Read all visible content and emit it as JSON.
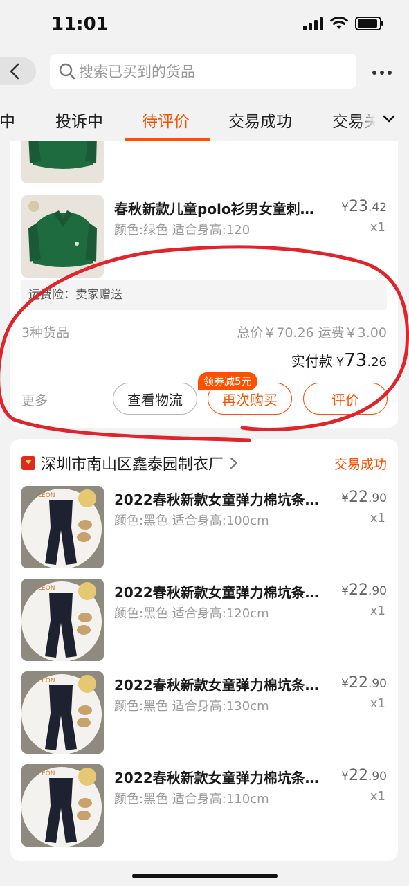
{
  "status_bar": {
    "time": "11:01"
  },
  "search": {
    "placeholder": "搜索已买到的货品"
  },
  "tabs": [
    {
      "label": "售中"
    },
    {
      "label": "投诉中"
    },
    {
      "label": "待评价",
      "active": true
    },
    {
      "label": "交易成功"
    },
    {
      "label": "交易关闭"
    }
  ],
  "order1": {
    "item": {
      "title": "春秋新款儿童polo衫男女童刺…",
      "sku": "颜色:绿色  适合身高:120",
      "price_currency": "¥",
      "price_int": "23",
      "price_dec": ".42",
      "qty": "x1"
    },
    "insurance": "运费险：卖家赠送",
    "goods_count": "3种货品",
    "total": "总价￥70.26   运费￥3.00",
    "paid_label": "实付款",
    "paid_currency": "¥",
    "paid_int": "73",
    "paid_dec": ".26",
    "more": "更多",
    "coupon_badge": "领券减5元",
    "btn_logistics": "查看物流",
    "btn_rebuy": "再次购买",
    "btn_review": "评价"
  },
  "order2": {
    "shop_name": "深圳市南山区鑫泰园制衣厂",
    "status": "交易成功",
    "items": [
      {
        "title": "2022春秋新款女童弹力棉坑条…",
        "sku": "颜色:黑色  适合身高:100cm",
        "price_currency": "¥",
        "price_int": "22",
        "price_dec": ".90",
        "qty": "x1"
      },
      {
        "title": "2022春秋新款女童弹力棉坑条…",
        "sku": "颜色:黑色  适合身高:120cm",
        "price_currency": "¥",
        "price_int": "22",
        "price_dec": ".90",
        "qty": "x1"
      },
      {
        "title": "2022春秋新款女童弹力棉坑条…",
        "sku": "颜色:黑色  适合身高:130cm",
        "price_currency": "¥",
        "price_int": "22",
        "price_dec": ".90",
        "qty": "x1"
      },
      {
        "title": "2022春秋新款女童弹力棉坑条…",
        "sku": "颜色:黑色  适合身高:110cm",
        "price_currency": "¥",
        "price_int": "22",
        "price_dec": ".90",
        "qty": "x1"
      }
    ]
  },
  "colors": {
    "accent": "#ff5000",
    "annotation": "#e0242c",
    "background": "#f2f2f2"
  },
  "icons": [
    "search-icon",
    "back-arrow-icon",
    "more-dots-icon",
    "chevron-down-icon",
    "shop-icon",
    "chevron-right-icon"
  ]
}
